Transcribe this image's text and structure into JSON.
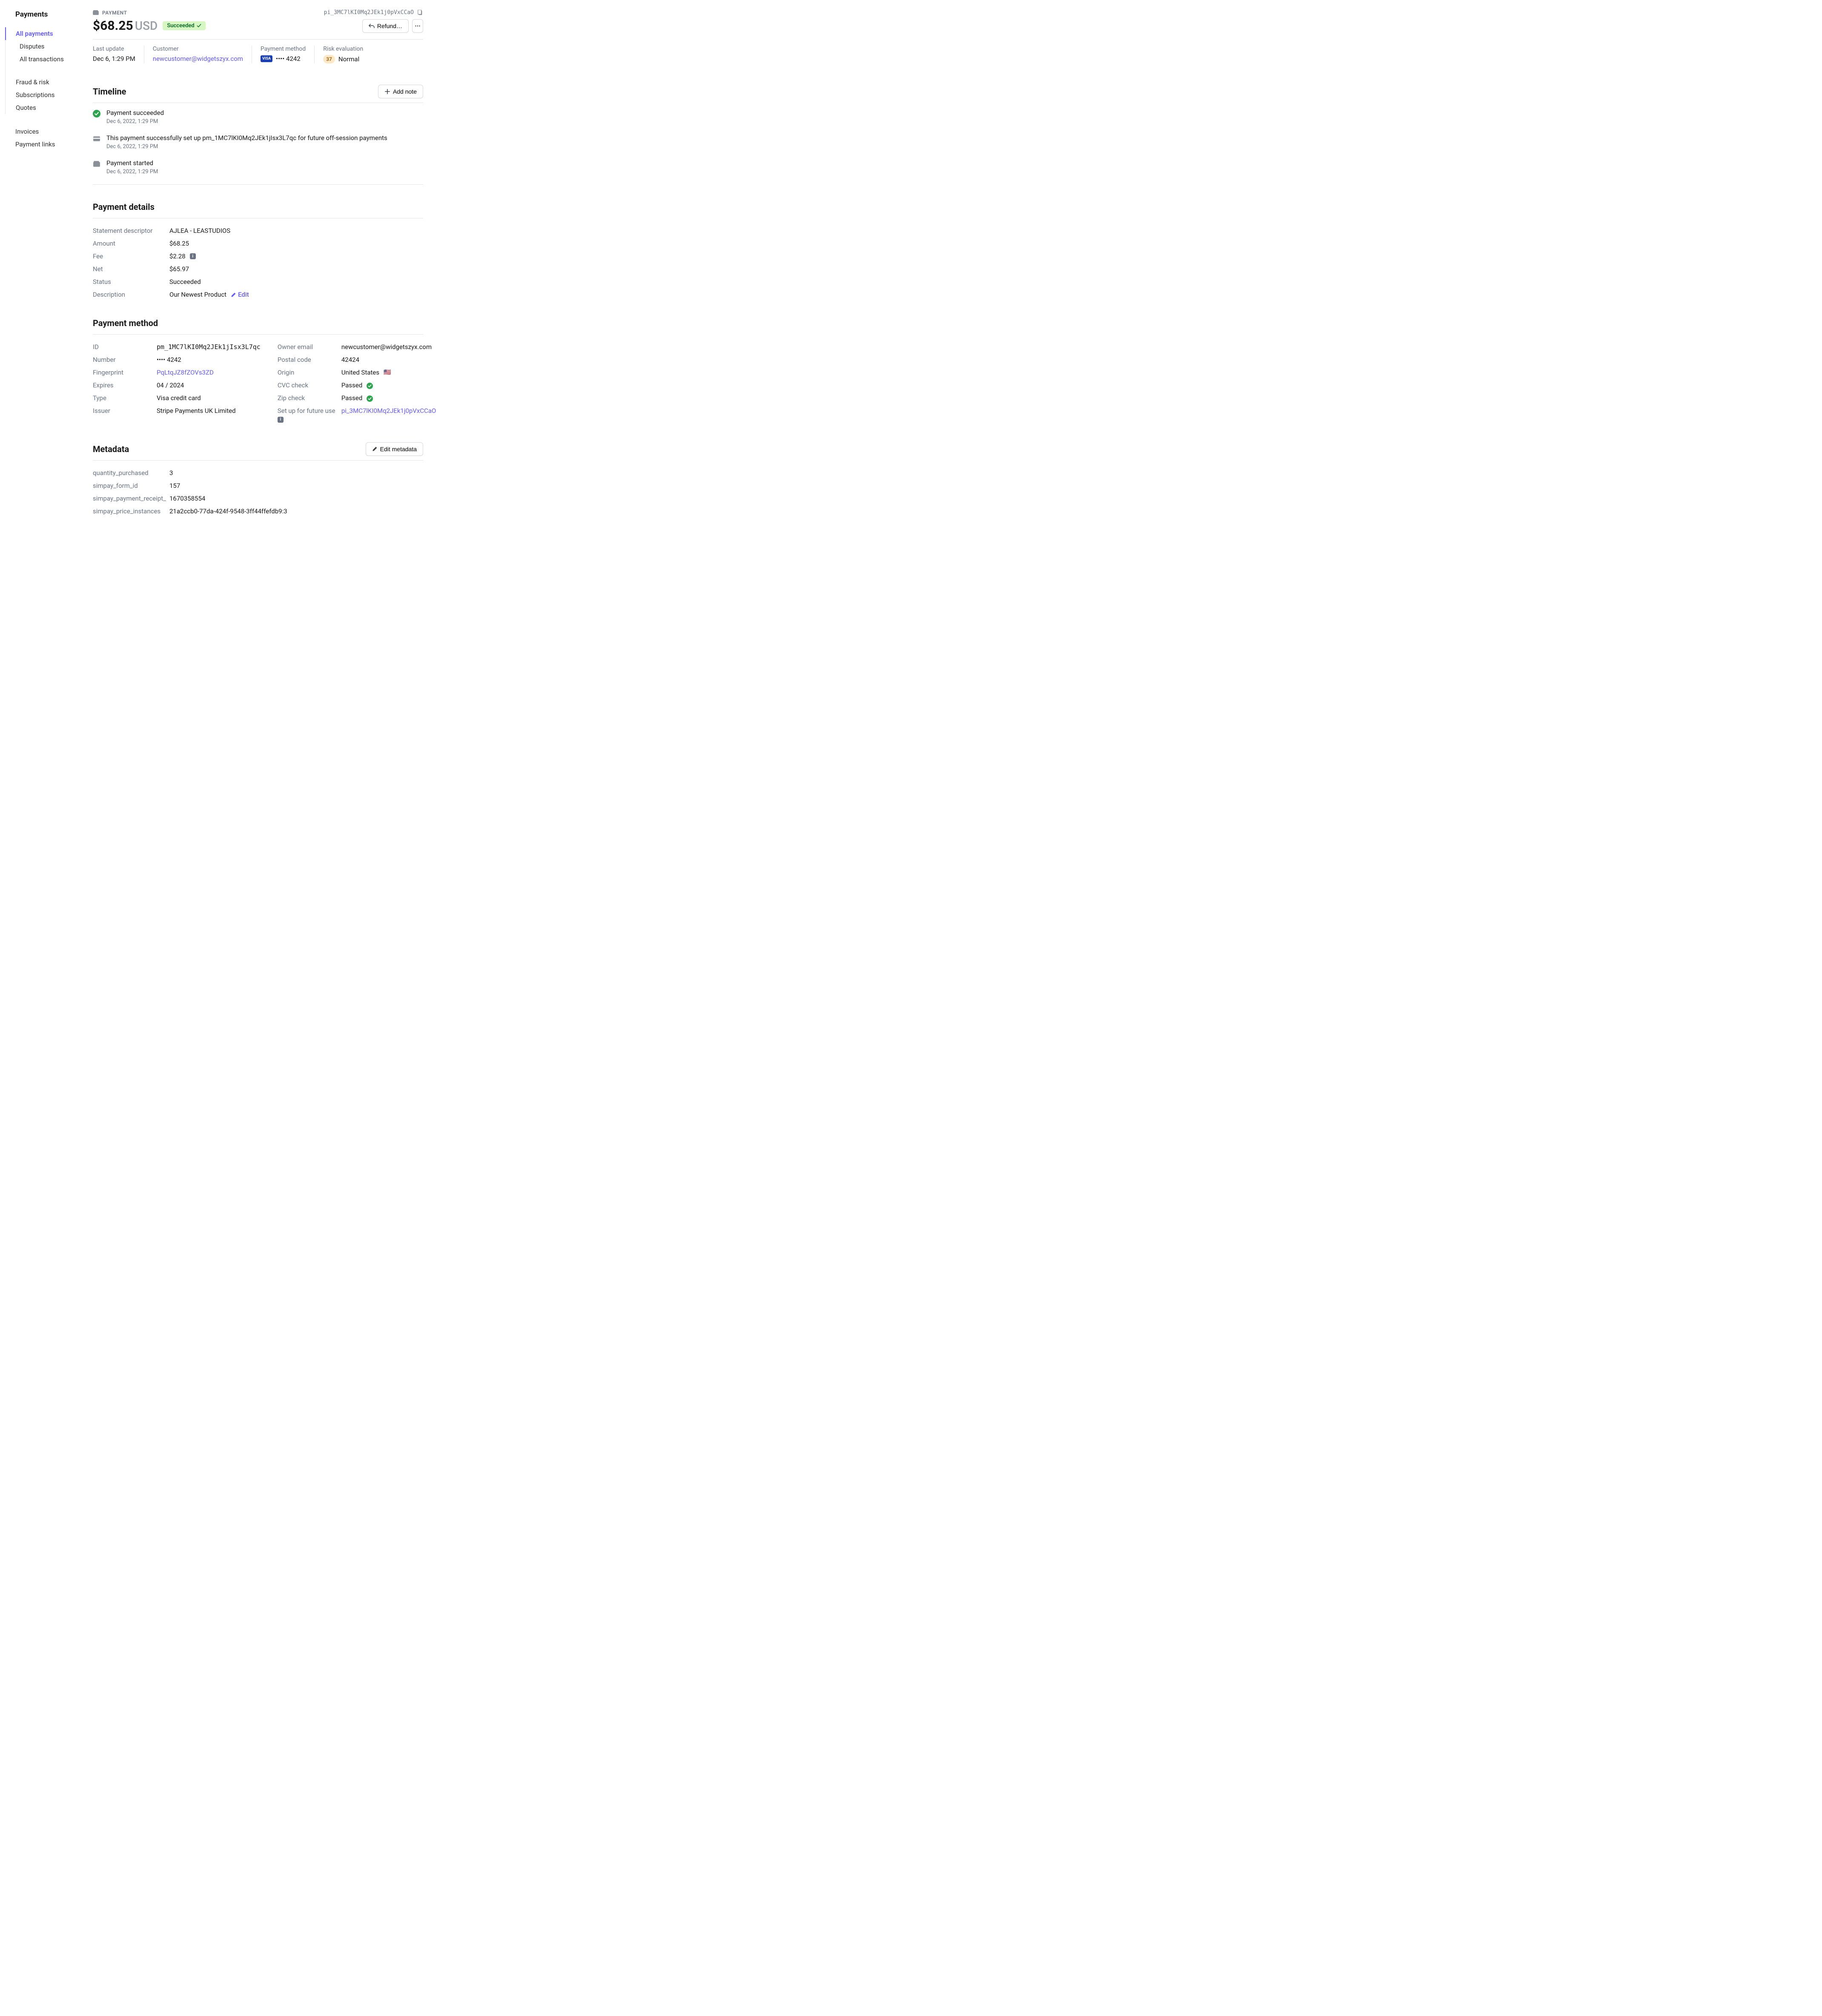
{
  "sidebar": {
    "title": "Payments",
    "items": [
      {
        "label": "All payments",
        "active": true
      },
      {
        "label": "Disputes"
      },
      {
        "label": "All transactions"
      }
    ],
    "items2": [
      {
        "label": "Fraud & risk"
      },
      {
        "label": "Subscriptions"
      },
      {
        "label": "Quotes"
      }
    ],
    "items3": [
      {
        "label": "Invoices"
      },
      {
        "label": "Payment links"
      }
    ]
  },
  "header": {
    "type_label": "PAYMENT",
    "payment_id": "pi_3MC7lKI0Mq2JEk1j0pVxCCaO",
    "amount": "$68.25",
    "currency": "USD",
    "status": "Succeeded",
    "refund_label": "Refund…"
  },
  "summary": {
    "last_update_label": "Last update",
    "last_update": "Dec 6, 1:29 PM",
    "customer_label": "Customer",
    "customer_email": "newcustomer@widgetszyx.com",
    "method_label": "Payment method",
    "card_brand": "VISA",
    "card_last4": "•••• 4242",
    "risk_label": "Risk evaluation",
    "risk_score": "37",
    "risk_text": "Normal"
  },
  "timeline": {
    "title": "Timeline",
    "add_note_label": "Add note",
    "items": [
      {
        "text": "Payment succeeded",
        "time": "Dec 6, 2022, 1:29 PM",
        "icon": "success"
      },
      {
        "text": "This payment successfully set up pm_1MC7lKI0Mq2JEk1jIsx3L7qc for future off-session payments",
        "time": "Dec 6, 2022, 1:29 PM",
        "icon": "card"
      },
      {
        "text": "Payment started",
        "time": "Dec 6, 2022, 1:29 PM",
        "icon": "wallet"
      }
    ]
  },
  "details": {
    "title": "Payment details",
    "rows": {
      "statement_descriptor_label": "Statement descriptor",
      "statement_descriptor": "AJLEA - LEASTUDIOS",
      "amount_label": "Amount",
      "amount": "$68.25",
      "fee_label": "Fee",
      "fee": "$2.28",
      "net_label": "Net",
      "net": "$65.97",
      "status_label": "Status",
      "status": "Succeeded",
      "description_label": "Description",
      "description": "Our Newest Product",
      "edit_label": "Edit"
    }
  },
  "method": {
    "title": "Payment method",
    "left": {
      "id_label": "ID",
      "id": "pm_1MC7lKI0Mq2JEk1jIsx3L7qc",
      "number_label": "Number",
      "number": "•••• 4242",
      "fingerprint_label": "Fingerprint",
      "fingerprint": "PqLtqJZ8fZOVs3ZD",
      "expires_label": "Expires",
      "expires": "04 / 2024",
      "type_label": "Type",
      "type": "Visa credit card",
      "issuer_label": "Issuer",
      "issuer": "Stripe Payments UK Limited"
    },
    "right": {
      "owner_email_label": "Owner email",
      "owner_email": "newcustomer@widgetszyx.com",
      "postal_label": "Postal code",
      "postal": "42424",
      "origin_label": "Origin",
      "origin": "United States",
      "cvc_label": "CVC check",
      "cvc": "Passed",
      "zip_label": "Zip check",
      "zip": "Passed",
      "future_label": "Set up for future use",
      "future": "pi_3MC7lKI0Mq2JEk1j0pVxCCaO"
    }
  },
  "metadata": {
    "title": "Metadata",
    "edit_label": "Edit metadata",
    "rows": [
      {
        "k": "quantity_purchased",
        "v": "3"
      },
      {
        "k": "simpay_form_id",
        "v": "157"
      },
      {
        "k": "simpay_payment_receipt_",
        "v": "1670358554"
      },
      {
        "k": "simpay_price_instances",
        "v": "21a2ccb0-77da-424f-9548-3ff44ffefdb9:3"
      }
    ]
  }
}
